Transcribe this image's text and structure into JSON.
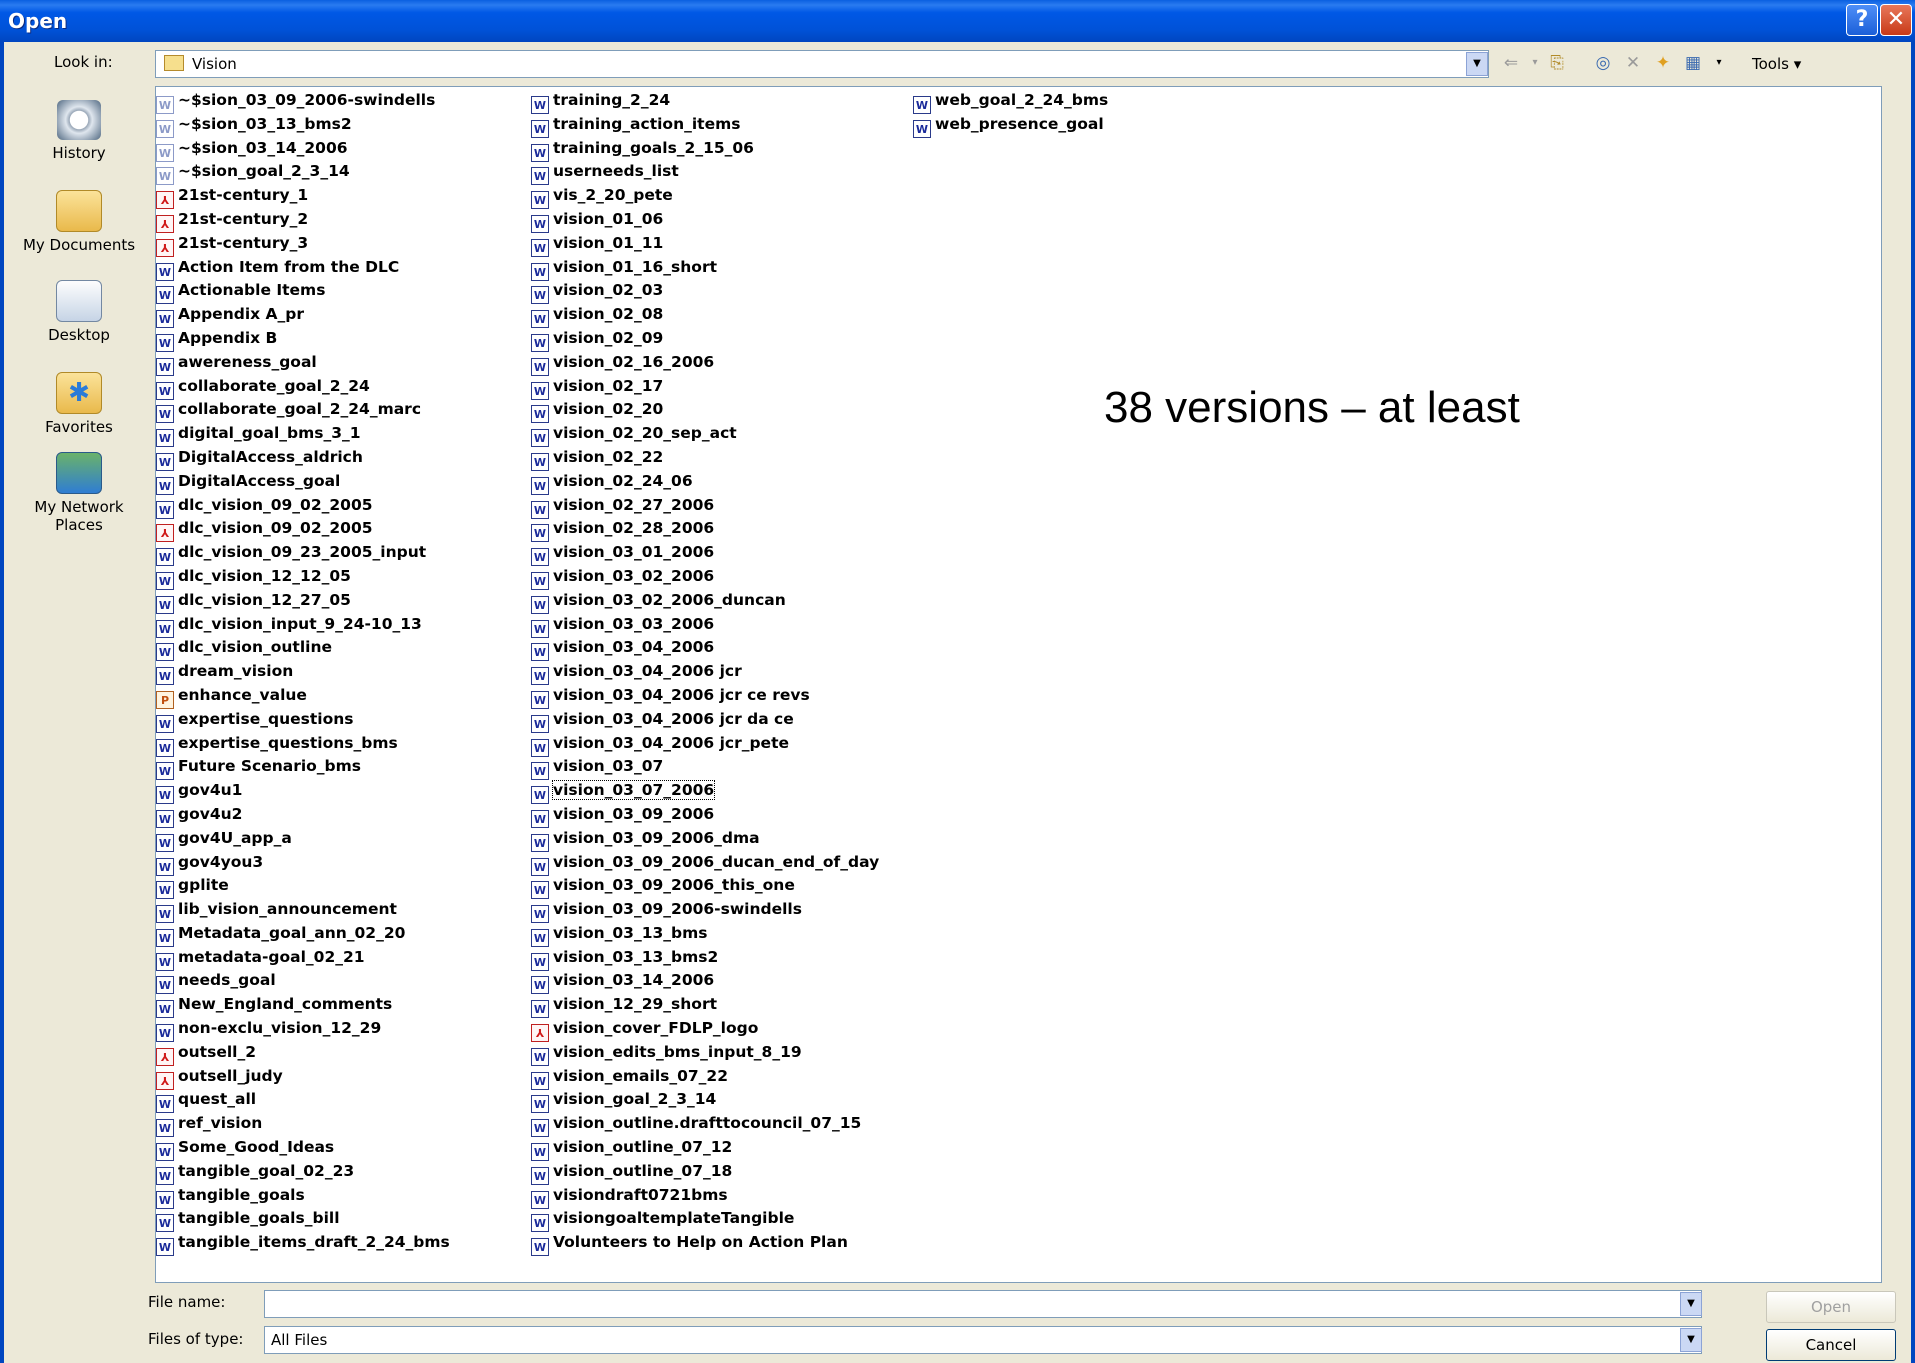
{
  "window": {
    "title": "Open",
    "help_glyph": "?",
    "close_glyph": "✕"
  },
  "toolbar": {
    "look_in_label": "Look in:",
    "look_in_value": "Vision",
    "tools_label": "Tools ▾",
    "icons": [
      "back-arrow-icon",
      "up-folder-icon",
      "search-web-icon",
      "delete-icon",
      "new-folder-icon",
      "views-icon"
    ]
  },
  "places": [
    {
      "label": "History",
      "icon": "history-icon"
    },
    {
      "label": "My Documents",
      "icon": "my-documents-icon"
    },
    {
      "label": "Desktop",
      "icon": "desktop-icon"
    },
    {
      "label": "Favorites",
      "icon": "favorites-icon"
    },
    {
      "label": "My Network Places",
      "icon": "network-places-icon"
    }
  ],
  "files": {
    "col1": [
      {
        "name": "~$sion_03_09_2006-swindells",
        "type": "temp"
      },
      {
        "name": "~$sion_03_13_bms2",
        "type": "temp"
      },
      {
        "name": "~$sion_03_14_2006",
        "type": "temp"
      },
      {
        "name": "~$sion_goal_2_3_14",
        "type": "temp"
      },
      {
        "name": "21st-century_1",
        "type": "pdf"
      },
      {
        "name": "21st-century_2",
        "type": "pdf"
      },
      {
        "name": "21st-century_3",
        "type": "pdf"
      },
      {
        "name": "Action Item from the DLC",
        "type": "word"
      },
      {
        "name": "Actionable Items",
        "type": "word"
      },
      {
        "name": "Appendix A_pr",
        "type": "word"
      },
      {
        "name": "Appendix B",
        "type": "word"
      },
      {
        "name": "awereness_goal",
        "type": "word"
      },
      {
        "name": "collaborate_goal_2_24",
        "type": "word"
      },
      {
        "name": "collaborate_goal_2_24_marc",
        "type": "word"
      },
      {
        "name": "digital_goal_bms_3_1",
        "type": "word"
      },
      {
        "name": "DigitalAccess_aldrich",
        "type": "word"
      },
      {
        "name": "DigitalAccess_goal",
        "type": "word"
      },
      {
        "name": "dlc_vision_09_02_2005",
        "type": "word"
      },
      {
        "name": "dlc_vision_09_02_2005",
        "type": "pdf"
      },
      {
        "name": "dlc_vision_09_23_2005_input",
        "type": "word"
      },
      {
        "name": "dlc_vision_12_12_05",
        "type": "word"
      },
      {
        "name": "dlc_vision_12_27_05",
        "type": "word"
      },
      {
        "name": "dlc_vision_input_9_24-10_13",
        "type": "word"
      },
      {
        "name": "dlc_vision_outline",
        "type": "word"
      },
      {
        "name": "dream_vision",
        "type": "word"
      },
      {
        "name": "enhance_value",
        "type": "pub"
      },
      {
        "name": "expertise_questions",
        "type": "word"
      },
      {
        "name": "expertise_questions_bms",
        "type": "word"
      },
      {
        "name": "Future Scenario_bms",
        "type": "word"
      },
      {
        "name": "gov4u1",
        "type": "word"
      },
      {
        "name": "gov4u2",
        "type": "word"
      },
      {
        "name": "gov4U_app_a",
        "type": "word"
      },
      {
        "name": "gov4you3",
        "type": "word"
      },
      {
        "name": "gplite",
        "type": "word"
      },
      {
        "name": "lib_vision_announcement",
        "type": "word"
      },
      {
        "name": "Metadata_goal_ann_02_20",
        "type": "word"
      },
      {
        "name": "metadata-goal_02_21",
        "type": "word"
      },
      {
        "name": "needs_goal",
        "type": "word"
      },
      {
        "name": "New_England_comments",
        "type": "word"
      },
      {
        "name": "non-exclu_vision_12_29",
        "type": "word"
      },
      {
        "name": "outsell_2",
        "type": "pdf"
      },
      {
        "name": "outsell_judy",
        "type": "pdf"
      },
      {
        "name": "quest_all",
        "type": "word"
      },
      {
        "name": "ref_vision",
        "type": "word"
      },
      {
        "name": "Some_Good_Ideas",
        "type": "word"
      },
      {
        "name": "tangible_goal_02_23",
        "type": "word"
      },
      {
        "name": "tangible_goals",
        "type": "word"
      },
      {
        "name": "tangible_goals_bill",
        "type": "word"
      },
      {
        "name": "tangible_items_draft_2_24_bms",
        "type": "word"
      }
    ],
    "col2": [
      {
        "name": "training_2_24",
        "type": "word"
      },
      {
        "name": "training_action_items",
        "type": "word"
      },
      {
        "name": "training_goals_2_15_06",
        "type": "word"
      },
      {
        "name": "userneeds_list",
        "type": "word"
      },
      {
        "name": "vis_2_20_pete",
        "type": "word"
      },
      {
        "name": "vision_01_06",
        "type": "word"
      },
      {
        "name": "vision_01_11",
        "type": "word"
      },
      {
        "name": "vision_01_16_short",
        "type": "word"
      },
      {
        "name": "vision_02_03",
        "type": "word"
      },
      {
        "name": "vision_02_08",
        "type": "word"
      },
      {
        "name": "vision_02_09",
        "type": "word"
      },
      {
        "name": "vision_02_16_2006",
        "type": "word"
      },
      {
        "name": "vision_02_17",
        "type": "word"
      },
      {
        "name": "vision_02_20",
        "type": "word"
      },
      {
        "name": "vision_02_20_sep_act",
        "type": "word"
      },
      {
        "name": "vision_02_22",
        "type": "word"
      },
      {
        "name": "vision_02_24_06",
        "type": "word"
      },
      {
        "name": "vision_02_27_2006",
        "type": "word"
      },
      {
        "name": "vision_02_28_2006",
        "type": "word"
      },
      {
        "name": "vision_03_01_2006",
        "type": "word"
      },
      {
        "name": "vision_03_02_2006",
        "type": "word"
      },
      {
        "name": "vision_03_02_2006_duncan",
        "type": "word"
      },
      {
        "name": "vision_03_03_2006",
        "type": "word"
      },
      {
        "name": "vision_03_04_2006",
        "type": "word"
      },
      {
        "name": "vision_03_04_2006 jcr",
        "type": "word"
      },
      {
        "name": "vision_03_04_2006 jcr ce revs",
        "type": "word"
      },
      {
        "name": "vision_03_04_2006 jcr da ce",
        "type": "word"
      },
      {
        "name": "vision_03_04_2006 jcr_pete",
        "type": "word"
      },
      {
        "name": "vision_03_07",
        "type": "word"
      },
      {
        "name": "vision_03_07_2006",
        "type": "word",
        "focused": true
      },
      {
        "name": "vision_03_09_2006",
        "type": "word"
      },
      {
        "name": "vision_03_09_2006_dma",
        "type": "word"
      },
      {
        "name": "vision_03_09_2006_ducan_end_of_day",
        "type": "word"
      },
      {
        "name": "vision_03_09_2006_this_one",
        "type": "word"
      },
      {
        "name": "vision_03_09_2006-swindells",
        "type": "word"
      },
      {
        "name": "vision_03_13_bms",
        "type": "word"
      },
      {
        "name": "vision_03_13_bms2",
        "type": "word"
      },
      {
        "name": "vision_03_14_2006",
        "type": "word"
      },
      {
        "name": "vision_12_29_short",
        "type": "word"
      },
      {
        "name": "vision_cover_FDLP_logo",
        "type": "pdf"
      },
      {
        "name": "vision_edits_bms_input_8_19",
        "type": "word"
      },
      {
        "name": "vision_emails_07_22",
        "type": "word"
      },
      {
        "name": "vision_goal_2_3_14",
        "type": "word"
      },
      {
        "name": "vision_outline.drafttocouncil_07_15",
        "type": "word"
      },
      {
        "name": "vision_outline_07_12",
        "type": "word"
      },
      {
        "name": "vision_outline_07_18",
        "type": "word"
      },
      {
        "name": "visiondraft0721bms",
        "type": "word"
      },
      {
        "name": "visiongoaltemplateTangible",
        "type": "word"
      },
      {
        "name": "Volunteers to Help on Action Plan",
        "type": "word"
      }
    ],
    "col3": [
      {
        "name": "web_goal_2_24_bms",
        "type": "word"
      },
      {
        "name": "web_presence_goal",
        "type": "word"
      }
    ]
  },
  "annotation": "38 versions – at least",
  "footer": {
    "file_name_label": "File name:",
    "file_name_value": "",
    "file_type_label": "Files of type:",
    "file_type_value": "All Files",
    "open_label": "Open",
    "cancel_label": "Cancel"
  },
  "colors": {
    "title_bar": "#0052d8",
    "dialog_bg": "#ece9d8",
    "pdf_red": "#d01818",
    "word_blue": "#1a2a9a"
  }
}
